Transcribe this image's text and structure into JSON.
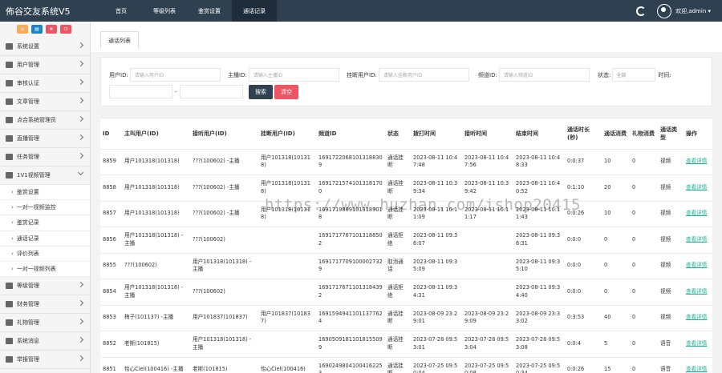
{
  "app": {
    "title": "佈谷交友系统V5"
  },
  "nav": {
    "tabs": [
      {
        "label": "首页"
      },
      {
        "label": "等级列表"
      },
      {
        "label": "鉴赏设置"
      },
      {
        "label": "通话记录"
      }
    ]
  },
  "user": {
    "label": "欢迎,admin ▾"
  },
  "quick": [
    {
      "icon": "home-icon",
      "color": "#f8ac59"
    },
    {
      "icon": "document-icon",
      "color": "#1c84c6"
    },
    {
      "icon": "star-icon",
      "color": "#ed5565"
    },
    {
      "icon": "power-icon",
      "color": "#ed5565"
    }
  ],
  "sidebar": {
    "items": [
      {
        "label": "系统设置",
        "icon": "gear-icon"
      },
      {
        "label": "用户管理",
        "icon": "users-icon"
      },
      {
        "label": "审核认证",
        "icon": "check-icon"
      },
      {
        "label": "文章管理",
        "icon": "document-icon"
      },
      {
        "label": "点合系统管理员",
        "icon": "user-icon"
      },
      {
        "label": "直播管理",
        "icon": "video-icon"
      },
      {
        "label": "任务管理",
        "icon": "list-icon"
      },
      {
        "label": "1V1视频管理",
        "icon": "camera-icon"
      }
    ],
    "sub_items": [
      {
        "label": "鉴赏设置"
      },
      {
        "label": "一对一视频监控"
      },
      {
        "label": "鉴赏记录"
      },
      {
        "label": "通话记录"
      },
      {
        "label": "评价列表"
      },
      {
        "label": "一对一视频列表"
      }
    ],
    "items_after": [
      {
        "label": "等级管理",
        "icon": "layers-icon"
      },
      {
        "label": "财务管理",
        "icon": "yen-icon"
      },
      {
        "label": "礼物管理",
        "icon": "gift-icon"
      },
      {
        "label": "系统消息",
        "icon": "bell-icon"
      },
      {
        "label": "举报管理",
        "icon": "warning-icon"
      }
    ]
  },
  "content": {
    "tab_label": "通话列表"
  },
  "search": {
    "user_label": "用户ID:",
    "user_placeholder": "请输入用户ID",
    "anchor_label": "主播ID:",
    "anchor_placeholder": "请输入主播ID",
    "hangup_label": "挂断用户ID:",
    "hangup_placeholder": "请输入挂断用户ID",
    "channel_label": "频道ID:",
    "channel_placeholder": "请输入频道ID",
    "status_label": "状态:",
    "status_value": "全部",
    "time_label": "时间:",
    "time_sep": "-",
    "search_button": "搜索",
    "clear_button": "清空"
  },
  "table": {
    "headers": [
      "ID",
      "主叫用户(ID)",
      "接听用户(ID)",
      "挂断用户(ID)",
      "频道ID",
      "状态",
      "拨打时间",
      "接听时间",
      "结束时间",
      "通话时长(秒)",
      "通话消费",
      "礼物消费",
      "通话类型",
      "操作"
    ],
    "rows": [
      [
        "8859",
        "用户101318(101318)",
        "???(100602) -主播",
        "用户101318(101318)",
        "16917220681013188309",
        "通话挂断",
        "2023-08-11 10:47:48",
        "2023-08-11 10:47:56",
        "2023-08-11 10:48:33",
        "0:0:37",
        "10",
        "0",
        "视频",
        "查看详情"
      ],
      [
        "8858",
        "用户101318(101318)",
        "???(100602) -主播",
        "用户101318(101318)",
        "16917215741013181700",
        "通话挂断",
        "2023-08-11 10:39:34",
        "2023-08-11 10:39:42",
        "2023-08-11 10:40:52",
        "0:1:10",
        "20",
        "0",
        "视频",
        "查看详情"
      ],
      [
        "8857",
        "用户101318(101318)",
        "???(100602) -主播",
        "用户101318(101318)",
        "16917198691013189018",
        "通话挂断",
        "2023-08-11 10:11:09",
        "2023-08-11 10:11:17",
        "2023-08-11 10:11:43",
        "0:0:26",
        "10",
        "0",
        "视频",
        "查看详情"
      ],
      [
        "8856",
        "用户101318(101318) -主播",
        "???(100602)",
        "",
        "16917177671013188502",
        "通话拒绝",
        "2023-08-11 09:36:07",
        "",
        "2023-08-11 09:36:31",
        "0:0:0",
        "0",
        "0",
        "视频",
        "查看详情"
      ],
      [
        "8855",
        "???(100602)",
        "用户101318(101318) -主播",
        "",
        "16917177091000027329",
        "取消通话",
        "2023-08-11 09:35:09",
        "",
        "2023-08-11 09:35:10",
        "0:0:0",
        "0",
        "0",
        "视频",
        "查看详情"
      ],
      [
        "8854",
        "用户101318(101318) -主播",
        "???(100602)",
        "",
        "16917176711013184392",
        "通话拒绝",
        "2023-08-11 09:34:31",
        "",
        "2023-08-11 09:34:40",
        "0:0:0",
        "0",
        "0",
        "视频",
        "查看详情"
      ],
      [
        "8853",
        "梅子(101137) -主播",
        "用户101837(101837)",
        "用户101837(101837)",
        "16915949411011377624",
        "通话挂断",
        "2023-08-09 23:29:01",
        "2023-08-09 23:29:09",
        "2023-08-09 23:33:02",
        "0:3:53",
        "40",
        "0",
        "视频",
        "查看详情"
      ],
      [
        "8852",
        "老斯(101815)",
        "用户101318(101318) -主播",
        "",
        "16905091811018155099",
        "通话挂断",
        "2023-07-28 09:53:01",
        "2023-07-28 09:53:04",
        "2023-07-28 09:53:08",
        "0:0:4",
        "5",
        "0",
        "语音",
        "查看详情"
      ],
      [
        "8851",
        "怡心Ciel(100416) -主播",
        "老斯(101815)",
        "怡心Ciel(100416)",
        "16902498041004162253",
        "通话挂断",
        "2023-07-25 09:50:04",
        "2023-07-25 09:50:08",
        "2023-07-25 09:50:34",
        "0:0:26",
        "15",
        "0",
        "语音",
        "查看详情"
      ]
    ]
  },
  "watermark": "https://www.huzhan.com/ishop20415"
}
